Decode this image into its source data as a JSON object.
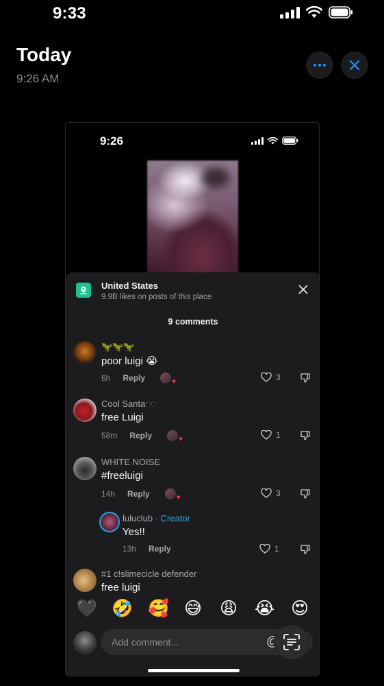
{
  "status_bar": {
    "time": "9:33"
  },
  "header": {
    "title": "Today",
    "subtitle": "9:26 AM"
  },
  "shot": {
    "status_time": "9:26",
    "location": {
      "title": "United States",
      "subtitle": "9.9B likes on posts of this place"
    },
    "comment_count": "9 comments",
    "comments": [
      {
        "name": "🦖🦖🦖",
        "text": "poor luigi 😭",
        "age": "6h",
        "reply": "Reply",
        "likes": "3"
      },
      {
        "name": "Cool Santa🕶️",
        "text": "free Luigi",
        "age": "58m",
        "reply": "Reply",
        "likes": "1"
      },
      {
        "name": "WHITE NOISE",
        "text": "#freeluigi",
        "age": "14h",
        "reply": "Reply",
        "likes": "3"
      },
      {
        "name": "luluclub",
        "creator_tag": " · Creator",
        "text": "Yes!!",
        "age": "13h",
        "reply": "Reply",
        "likes": "1"
      },
      {
        "name": "#1 c!slimecicle defender",
        "text": "free luigi"
      }
    ],
    "emojis": [
      "🖤",
      "🤣",
      "🥰",
      "😅",
      "😩",
      "😭",
      "😍"
    ],
    "composer": {
      "placeholder": "Add comment...",
      "mention_symbol": "@"
    }
  },
  "colors": {
    "background": "#000000",
    "sheet": "#1c1c1e",
    "creator": "#28a4e6",
    "location_icon": "#1fbf8f"
  }
}
